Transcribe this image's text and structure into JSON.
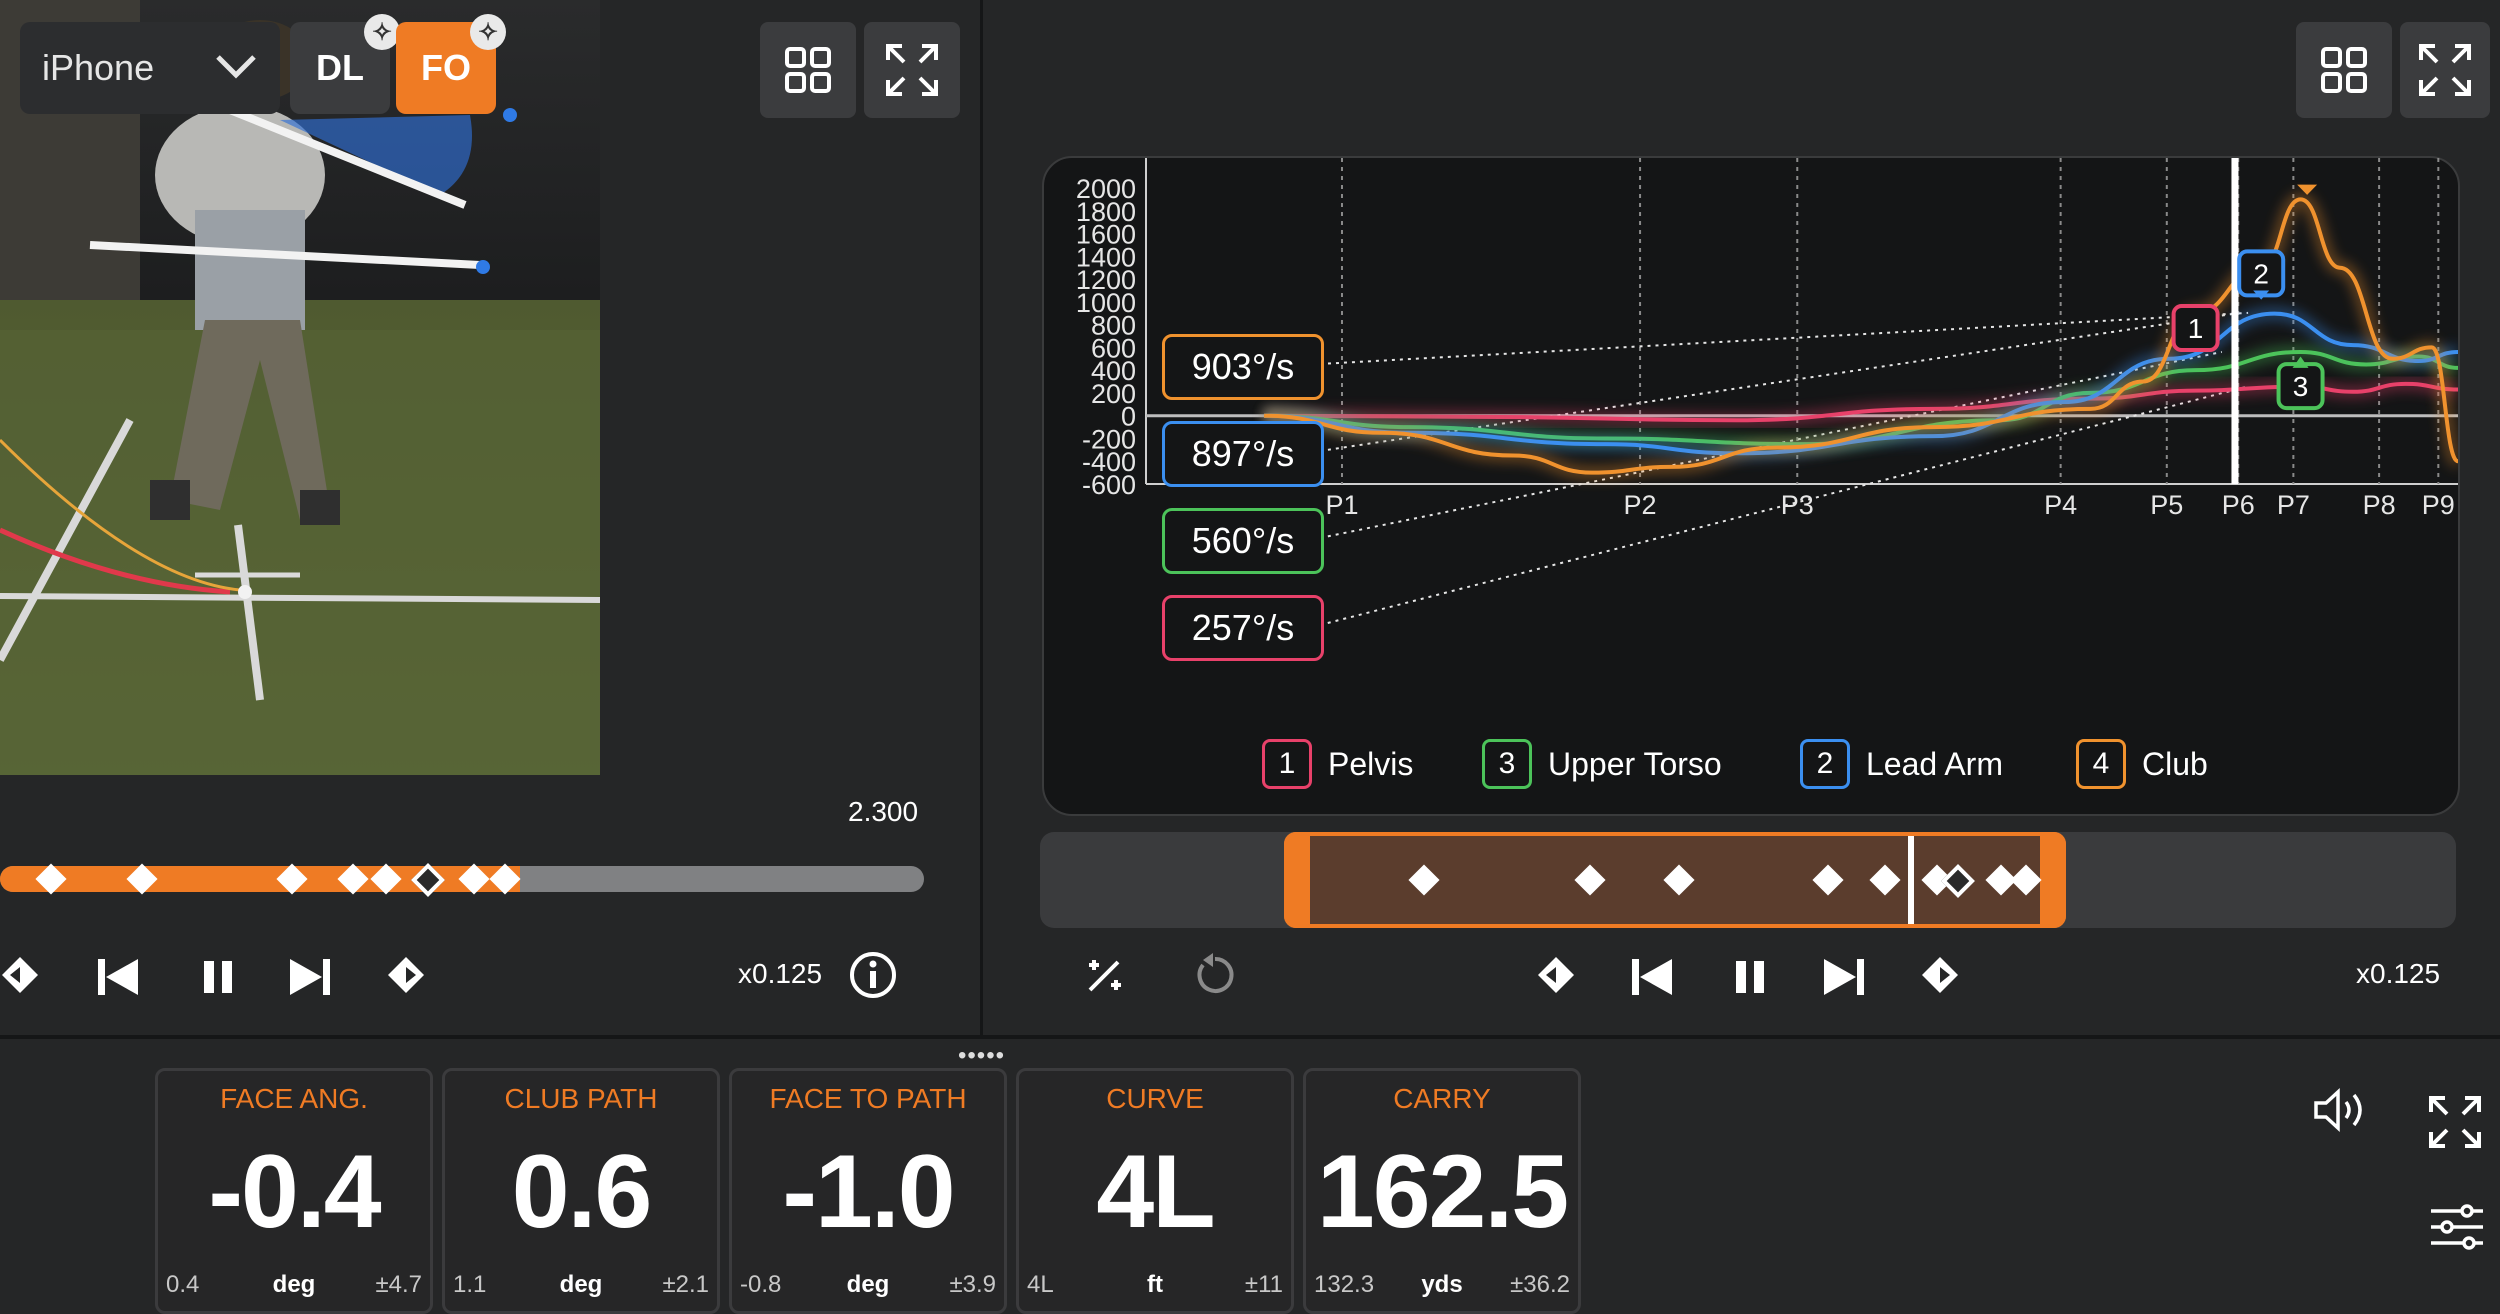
{
  "left": {
    "device_label": "iPhone",
    "mode_dl": "DL",
    "mode_fo": "FO",
    "time_value": "2.300",
    "speed": "x0.125"
  },
  "chart": {
    "y_ticks": [
      "2000",
      "1800",
      "1600",
      "1400",
      "1200",
      "1000",
      "800",
      "600",
      "400",
      "200",
      "0",
      "-200",
      "-400",
      "-600"
    ],
    "x_ticks": [
      "P1",
      "P2",
      "P3",
      "P4",
      "P5",
      "P6",
      "P7",
      "P8",
      "P9"
    ],
    "value_labels": [
      {
        "text": "903°/s",
        "color": "#f0922e"
      },
      {
        "text": "897°/s",
        "color": "#3b8ff0"
      },
      {
        "text": "560°/s",
        "color": "#4cc35a"
      },
      {
        "text": "257°/s",
        "color": "#e8416a"
      }
    ],
    "markers": [
      "1",
      "2",
      "3"
    ],
    "legend": [
      {
        "num": "1",
        "label": "Pelvis",
        "color": "#e8416a"
      },
      {
        "num": "3",
        "label": "Upper Torso",
        "color": "#4cc35a"
      },
      {
        "num": "2",
        "label": "Lead Arm",
        "color": "#3b8ff0"
      },
      {
        "num": "4",
        "label": "Club",
        "color": "#f0922e"
      }
    ],
    "speed": "x0.125"
  },
  "chart_data": {
    "type": "line",
    "ylim": [
      -600,
      2000
    ],
    "y_ticks": [
      2000,
      1800,
      1600,
      1400,
      1200,
      1000,
      800,
      600,
      400,
      200,
      0,
      -200,
      -400,
      -600
    ],
    "x_ticks": [
      "P1",
      "P2",
      "P3",
      "P4",
      "P5",
      "P6",
      "P7",
      "P8",
      "P9"
    ],
    "grid": true,
    "series": [
      {
        "name": "Pelvis",
        "peak": 257
      },
      {
        "name": "Upper Torso",
        "peak": 560
      },
      {
        "name": "Lead Arm",
        "peak": 897
      },
      {
        "name": "Club",
        "peak": 903
      }
    ]
  },
  "metrics": [
    {
      "title": "FACE ANG.",
      "value": "-0.4",
      "left": "0.4",
      "unit": "deg",
      "right": "±4.7"
    },
    {
      "title": "CLUB PATH",
      "value": "0.6",
      "left": "1.1",
      "unit": "deg",
      "right": "±2.1"
    },
    {
      "title": "FACE TO PATH",
      "value": "-1.0",
      "left": "-0.8",
      "unit": "deg",
      "right": "±3.9"
    },
    {
      "title": "CURVE",
      "value": "4L",
      "left": "4L",
      "unit": "ft",
      "right": "±11"
    },
    {
      "title": "CARRY",
      "value": "162.5",
      "left": "132.3",
      "unit": "yds",
      "right": "±36.2"
    }
  ],
  "colors": {
    "accent": "#ef7b24",
    "pelvis": "#e8416a",
    "torso": "#4cc35a",
    "arm": "#3b8ff0",
    "club": "#f0922e"
  }
}
